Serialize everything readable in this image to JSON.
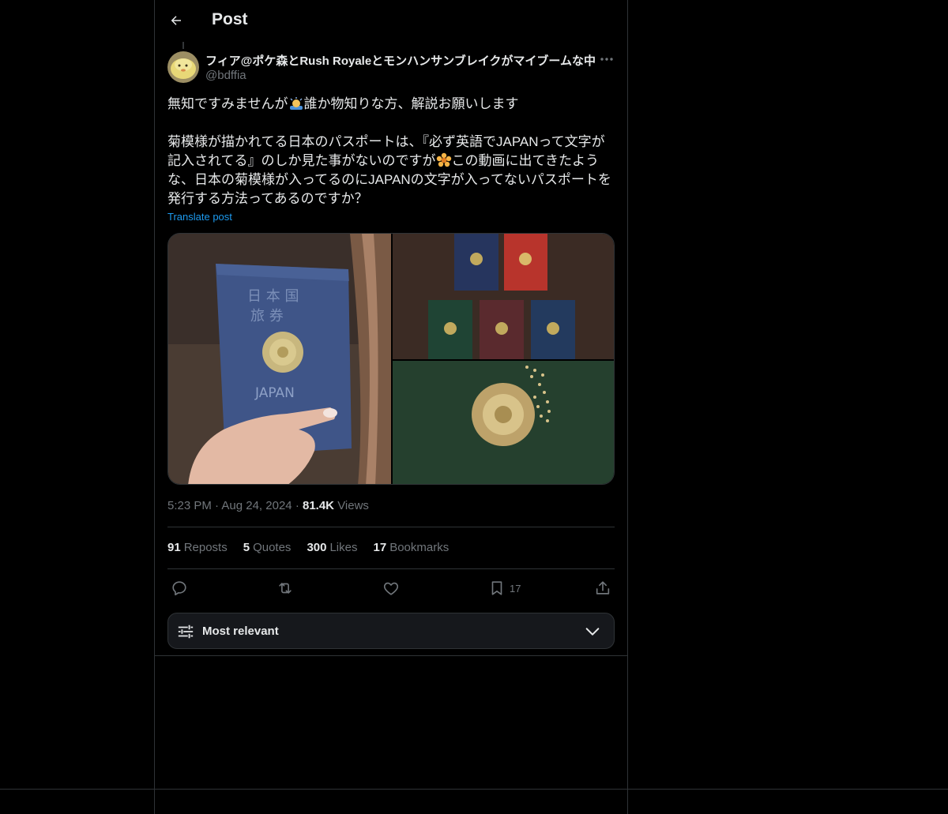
{
  "header": {
    "title": "Post"
  },
  "post": {
    "display_name": "フィア@ポケ森とRush Royaleとモンハンサンブレイクがマイブームな中",
    "handle": "@bdffia",
    "text_line1_a": "無知ですみませんが",
    "text_line1_b": "誰か物知りな方、解説お願いします",
    "text_para2_a": "菊模様が描かれてる日本のパスポートは、『必ず英語でJAPANって文字が記入されてる』のしか見た事がないのですが",
    "text_para2_b": "この動画に出てきたような、日本の菊模様が入ってるのにJAPANの文字が入ってないパスポートを発行する方法ってあるのですか？",
    "translate_label": "Translate post",
    "passport_cover_text": "JAPAN",
    "time": "5:23 PM",
    "date": "Aug 24, 2024",
    "views_count": "81.4K",
    "views_label": "Views",
    "separator": "·"
  },
  "stats": {
    "reposts_count": "91",
    "reposts_label": "Reposts",
    "quotes_count": "5",
    "quotes_label": "Quotes",
    "likes_count": "300",
    "likes_label": "Likes",
    "bookmarks_count": "17",
    "bookmarks_label": "Bookmarks"
  },
  "actions": {
    "bookmark_count": "17"
  },
  "sort": {
    "label": "Most relevant"
  },
  "icons": [
    "back-arrow-icon",
    "more-icon",
    "reply-icon",
    "repost-icon",
    "like-icon",
    "bookmark-icon",
    "share-icon",
    "sort-filter-icon",
    "chevron-down-icon"
  ],
  "colors": {
    "background": "#000000",
    "text": "#e7e9ea",
    "muted": "#71767b",
    "link": "#1d9bf0",
    "border": "#2f3336"
  }
}
